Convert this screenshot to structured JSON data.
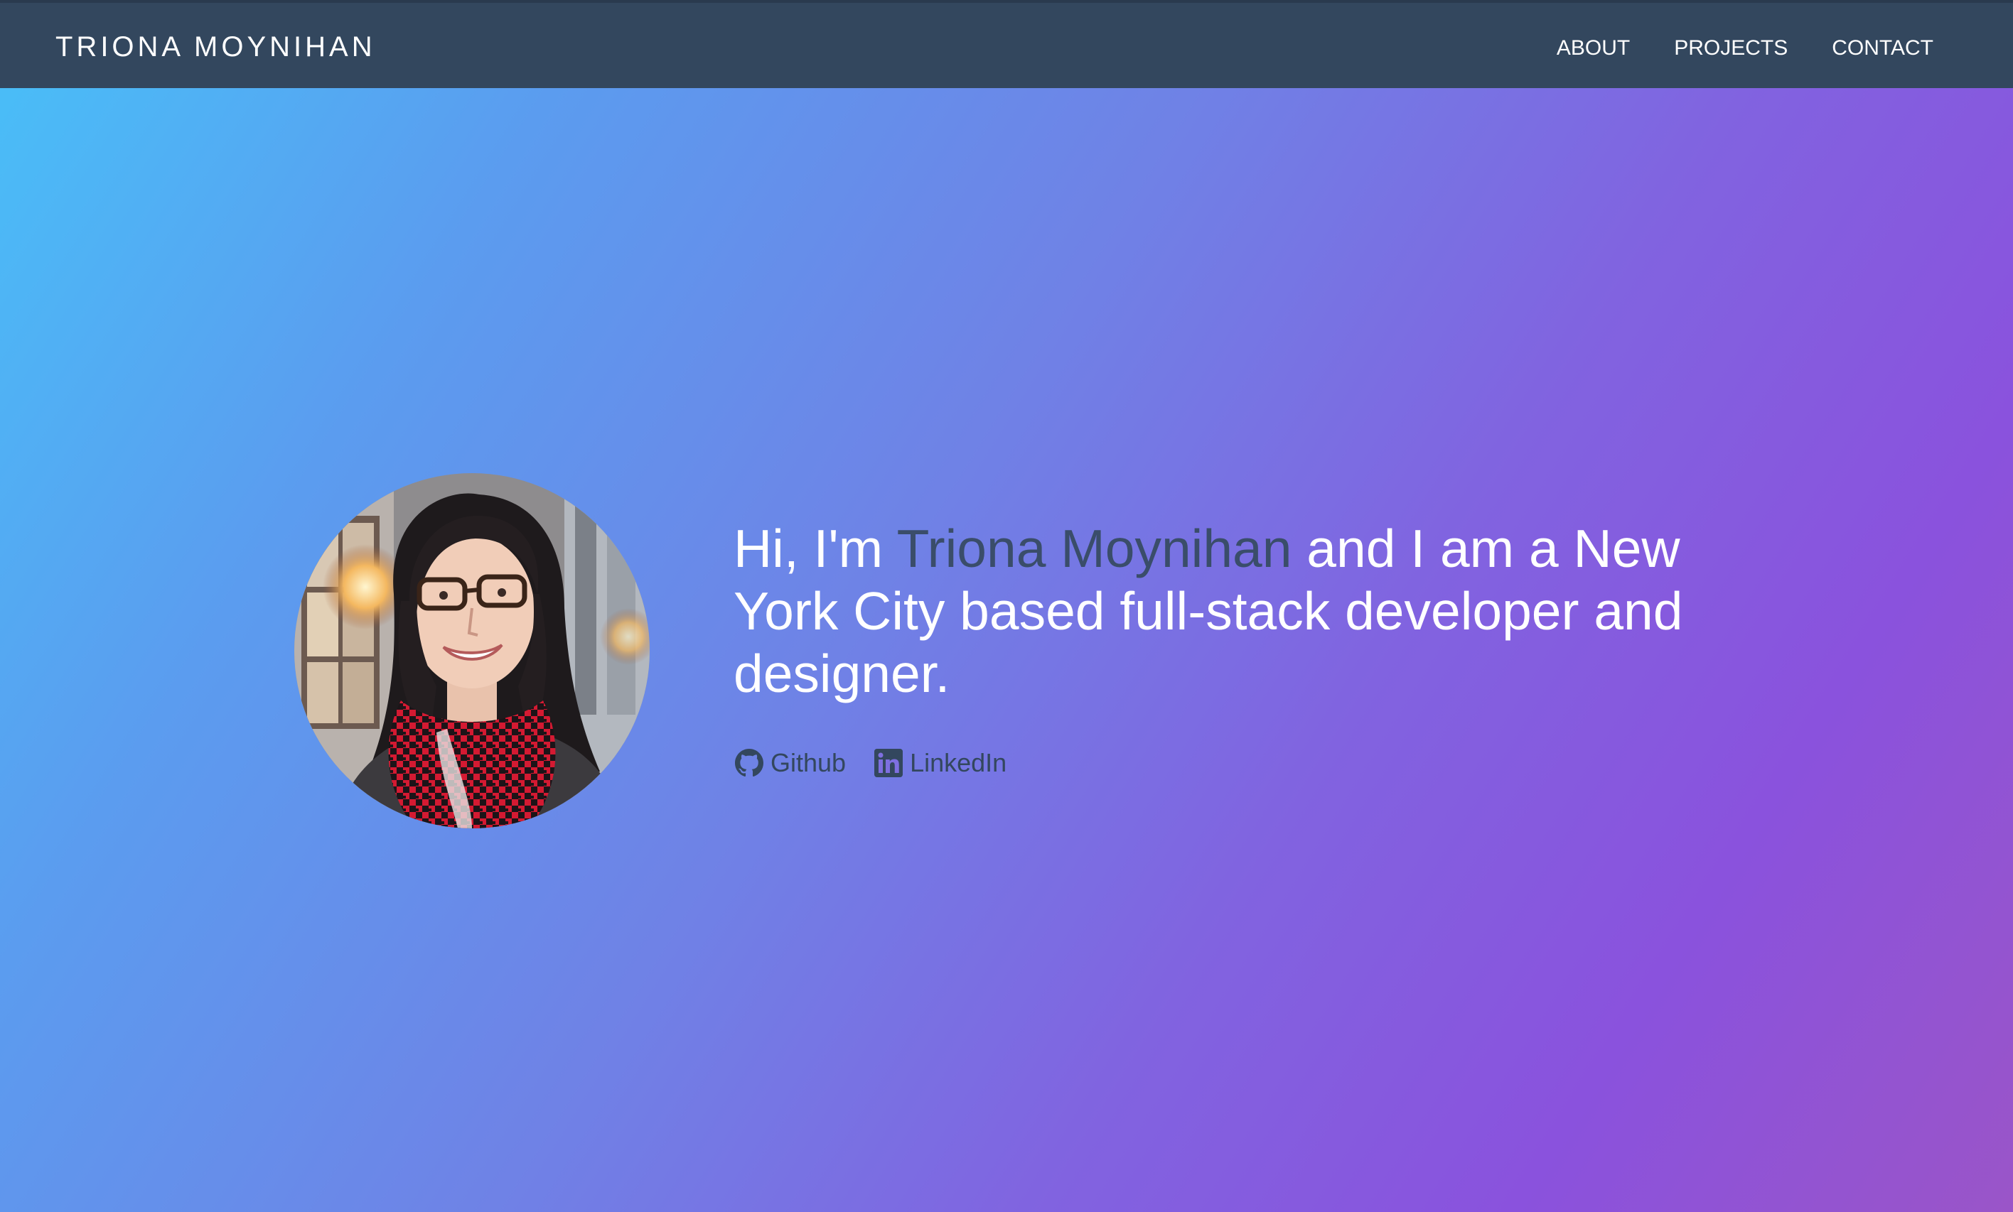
{
  "header": {
    "brand": "TRIONA MOYNIHAN",
    "nav": [
      {
        "label": "ABOUT"
      },
      {
        "label": "PROJECTS"
      },
      {
        "label": "CONTACT"
      }
    ]
  },
  "hero": {
    "avatar_alt": "Triona Moynihan",
    "intro_prefix": "Hi, I'm ",
    "intro_name": "Triona Moynihan",
    "intro_suffix": " and I am a New York City based full-stack developer and designer.",
    "links": [
      {
        "label": "Github",
        "icon": "github-icon"
      },
      {
        "label": "LinkedIn",
        "icon": "linkedin-icon"
      }
    ]
  },
  "colors": {
    "navbar": "#33475e",
    "gradient_start": "#48c0f8",
    "gradient_end": "#9a55c8",
    "name_highlight": "#3a4d6a",
    "link_text": "#33475e"
  }
}
